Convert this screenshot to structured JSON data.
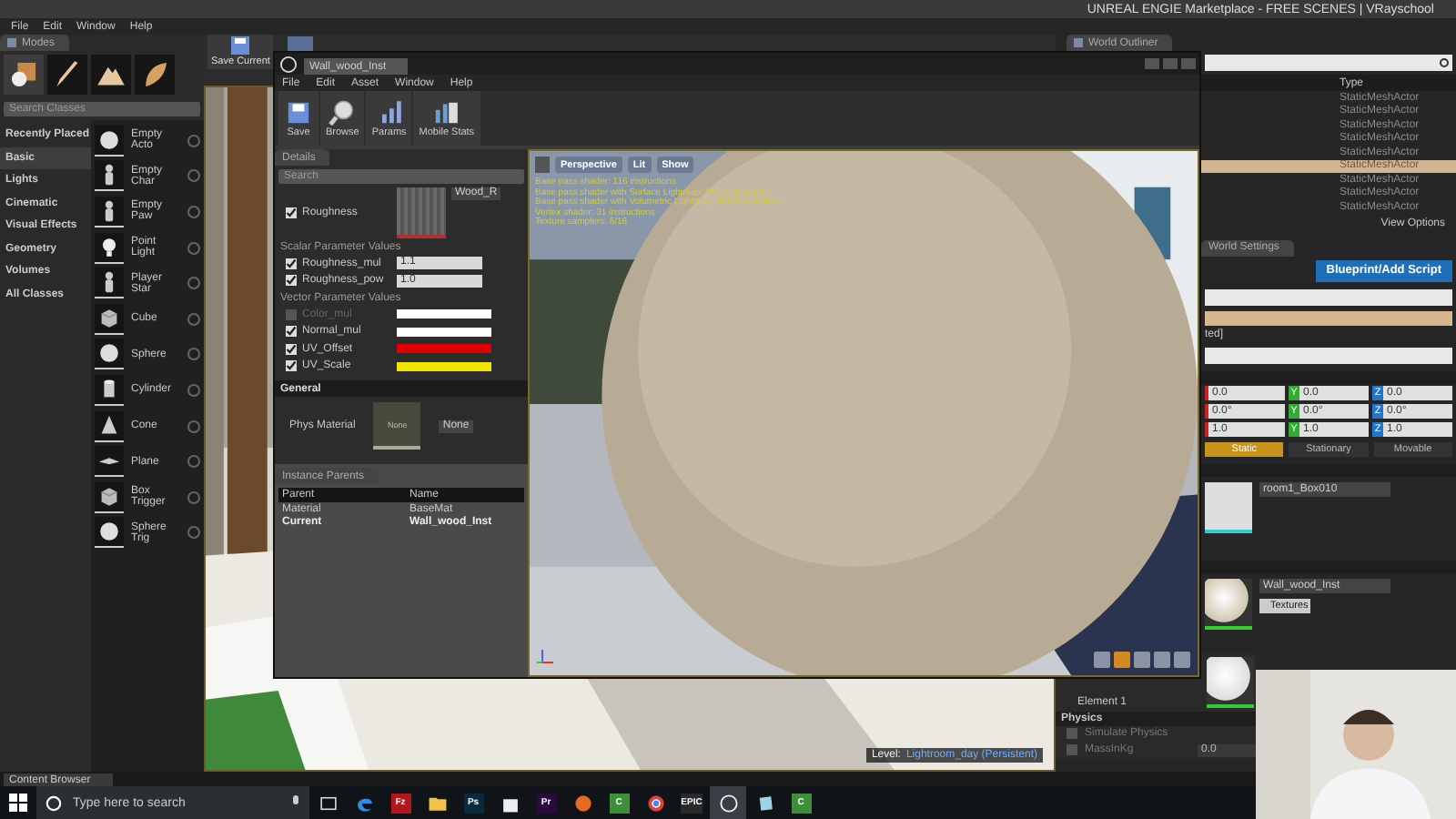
{
  "editor": {
    "title": "UNREAL ENGIE Marketplace - FREE SCENES |  VRayschool",
    "menu": [
      "File",
      "Edit",
      "Window",
      "Help"
    ],
    "save_button": "Save Current"
  },
  "modes": {
    "tab": "Modes",
    "mode_tabs": [
      {
        "kind": "place",
        "selected": true
      },
      {
        "kind": "paint",
        "selected": false
      },
      {
        "kind": "landscape",
        "selected": false
      },
      {
        "kind": "foliage",
        "selected": false
      }
    ],
    "search": {
      "placeholder": "Search Classes"
    },
    "categories": [
      {
        "label": "Recently Placed",
        "selected": false
      },
      {
        "label": "Basic",
        "selected": true
      },
      {
        "label": "Lights",
        "selected": false
      },
      {
        "label": "Cinematic",
        "selected": false
      },
      {
        "label": "Visual Effects",
        "selected": false
      },
      {
        "label": "Geometry",
        "selected": false
      },
      {
        "label": "Volumes",
        "selected": false
      },
      {
        "label": "All Classes",
        "selected": false
      }
    ],
    "items": [
      {
        "label": "Empty Acto",
        "kind": "sphere"
      },
      {
        "label": "Empty Char",
        "kind": "figure"
      },
      {
        "label": "Empty Paw",
        "kind": "figure"
      },
      {
        "label": "Point Light",
        "kind": "bulb"
      },
      {
        "label": "Player Star",
        "kind": "figure"
      },
      {
        "label": "Cube",
        "kind": "cube"
      },
      {
        "label": "Sphere",
        "kind": "sphere"
      },
      {
        "label": "Cylinder",
        "kind": "cylinder"
      },
      {
        "label": "Cone",
        "kind": "cone"
      },
      {
        "label": "Plane",
        "kind": "plane"
      },
      {
        "label": "Box Trigger",
        "kind": "cube"
      },
      {
        "label": "Sphere Trig",
        "kind": "sphere"
      }
    ]
  },
  "viewport": {
    "level_label": "Level:",
    "level": "Lightroom_day (Persistent)"
  },
  "outliner": {
    "tab": "World Outliner",
    "column": "Type",
    "rows": [
      {
        "type": "StaticMeshActor",
        "selected": false
      },
      {
        "type": "StaticMeshActor",
        "selected": false
      },
      {
        "type": "StaticMeshActor",
        "selected": false
      },
      {
        "type": "StaticMeshActor",
        "selected": false
      },
      {
        "type": "StaticMeshActor",
        "selected": false
      },
      {
        "type": "StaticMeshActor",
        "selected": true
      },
      {
        "type": "StaticMeshActor",
        "selected": false
      },
      {
        "type": "StaticMeshActor",
        "selected": false
      },
      {
        "type": "StaticMeshActor",
        "selected": false
      }
    ],
    "view_options": "View Options"
  },
  "world_settings": {
    "tab": "World Settings",
    "blueprint_button": "Blueprint/Add Script",
    "name_fragment": "ted]",
    "transform": [
      {
        "values": [
          "0.0",
          "0.0",
          "0.0"
        ],
        "axes": [
          "Y",
          "Z"
        ]
      },
      {
        "values": [
          "0.0°",
          "0.0°",
          "0.0°"
        ],
        "axes": [
          "Y",
          "Z"
        ]
      },
      {
        "values": [
          "1.0",
          "1.0",
          "1.0"
        ],
        "axes": [
          "Y",
          "Z"
        ]
      }
    ],
    "mobility": [
      {
        "label": "Static",
        "selected": true
      },
      {
        "label": "Stationary",
        "selected": false
      },
      {
        "label": "Movable",
        "selected": false
      }
    ],
    "mesh": "room1_Box010",
    "material": "Wall_wood_Inst",
    "textures_button": "Textures",
    "element": "Element 1",
    "physics": "Physics",
    "physics_rows": [
      {
        "label": "Simulate Physics",
        "checked": false
      },
      {
        "label": "MassInKg",
        "checked": false,
        "value": "0.0"
      }
    ]
  },
  "material_editor": {
    "tab": "Wall_wood_Inst",
    "menu": [
      "File",
      "Edit",
      "Asset",
      "Window",
      "Help"
    ],
    "toolbar": [
      {
        "label": "Save",
        "kind": "save"
      },
      {
        "label": "Browse",
        "kind": "browse"
      },
      {
        "label": "Params",
        "kind": "params"
      },
      {
        "label": "Mobile Stats",
        "kind": "stats"
      }
    ],
    "details": {
      "tab": "Details",
      "search": {
        "placeholder": "Search"
      },
      "texture_param": {
        "label": "Roughness",
        "checked": true,
        "texture": "Wood_R"
      },
      "scalar": {
        "title": "Scalar Parameter Values",
        "params": [
          {
            "label": "Roughness_mul",
            "checked": true,
            "value": "1.1"
          },
          {
            "label": "Roughness_pow",
            "checked": true,
            "value": "1.0"
          }
        ]
      },
      "vector": {
        "title": "Vector Parameter Values",
        "params": [
          {
            "label": "Color_mul",
            "checked": false,
            "color": "#ffffff"
          },
          {
            "label": "Normal_mul",
            "checked": true,
            "color": "#ffffff"
          },
          {
            "label": "UV_Offset",
            "checked": true,
            "color": "#e00000"
          },
          {
            "label": "UV_Scale",
            "checked": true,
            "color": "#f2e600"
          }
        ]
      },
      "general": {
        "title": "General",
        "label": "Phys Material",
        "thumb": "None",
        "value": "None"
      }
    },
    "instance_parents": {
      "tab": "Instance Parents",
      "columns": [
        "Parent",
        "Name"
      ],
      "rows": [
        {
          "parent": "Material",
          "name": "BaseMat",
          "current": false
        },
        {
          "parent": "Current",
          "name": "Wall_wood_Inst",
          "current": true
        }
      ]
    },
    "preview": {
      "buttons": [
        "Perspective",
        "Lit",
        "Show"
      ],
      "stats": [
        "Base pass shader: 116 instructions",
        "Base pass shader with Surface Lightmap: 150 instructions",
        "Base pass shader with Volumetric Lightmap: 189 instructions",
        "Vertex shader: 31 instructions",
        "Texture samplers: 6/16"
      ]
    }
  },
  "bottom_tab": "Content Browser",
  "taskbar": {
    "search": {
      "placeholder": "Type here to search"
    },
    "apps": [
      {
        "kind": "taskview"
      },
      {
        "kind": "edge"
      },
      {
        "kind": "label",
        "label": "Fz",
        "color": "#b3161b"
      },
      {
        "kind": "folder"
      },
      {
        "kind": "label",
        "label": "Ps",
        "color": "#0b2a3f"
      },
      {
        "kind": "store"
      },
      {
        "kind": "label",
        "label": "Pr",
        "color": "#2b0b3f"
      },
      {
        "kind": "firefox"
      },
      {
        "kind": "label",
        "label": "C",
        "color": "#3f8f3a"
      },
      {
        "kind": "chrome"
      },
      {
        "kind": "label",
        "label": "EPIC",
        "color": "#2a2a2a"
      },
      {
        "kind": "unreal"
      },
      {
        "kind": "notes"
      },
      {
        "kind": "label",
        "label": "C",
        "color": "#3f8f3a"
      }
    ]
  }
}
